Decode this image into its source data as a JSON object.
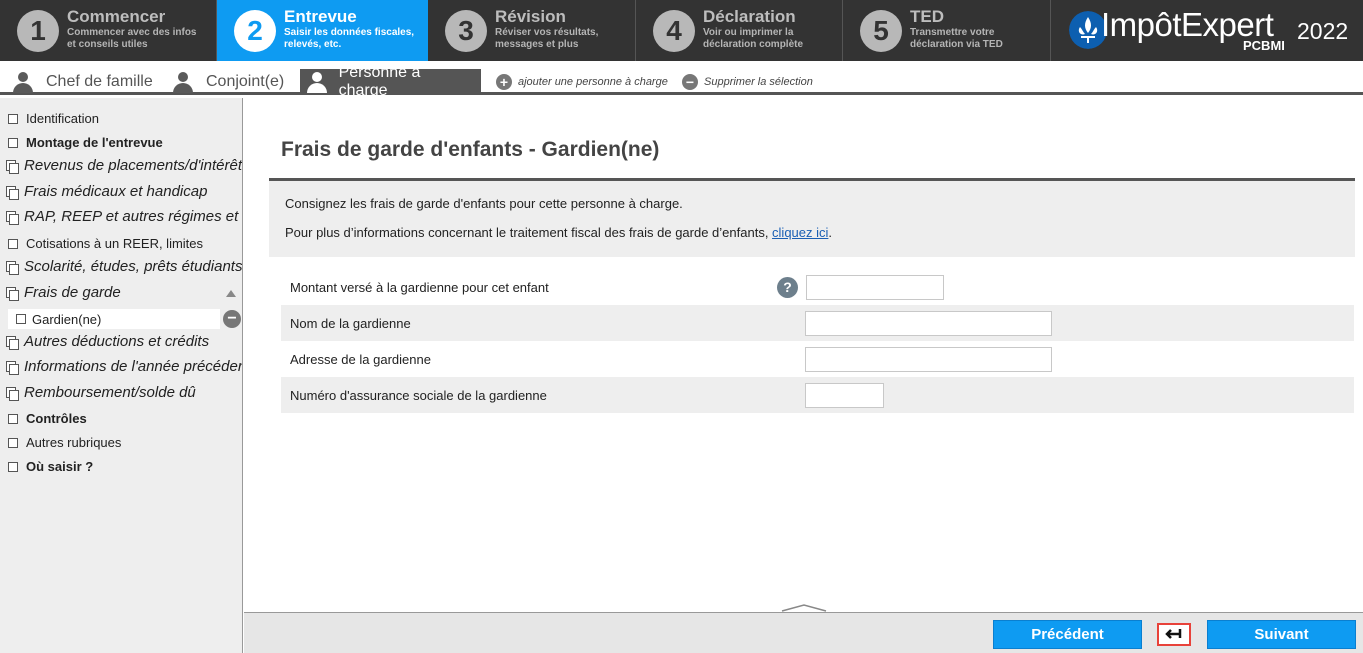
{
  "steps": [
    {
      "num": "1",
      "title": "Commencer",
      "desc1": "Commencer avec des infos",
      "desc2": "et conseils utiles"
    },
    {
      "num": "2",
      "title": "Entrevue",
      "desc1": "Saisir les données fiscales,",
      "desc2": "relevés, etc."
    },
    {
      "num": "3",
      "title": "Révision",
      "desc1": "Réviser vos résultats,",
      "desc2": "messages et plus"
    },
    {
      "num": "4",
      "title": "Déclaration",
      "desc1": "Voir ou imprimer la",
      "desc2": "déclaration complète"
    },
    {
      "num": "5",
      "title": "TED",
      "desc1": "Transmettre votre",
      "desc2": "déclaration via TED"
    }
  ],
  "brand": {
    "name": "ImpôtExpert",
    "year": "2022",
    "sub": "PCBMI"
  },
  "person_tabs": {
    "chef": "Chef de famille",
    "conjoint": "Conjoint(e)",
    "personne": "Personne à charge",
    "add": "ajouter une personne à charge",
    "remove": "Supprimer la sélection"
  },
  "sidebar": {
    "identification": "Identification",
    "montage": "Montage de l'entrevue",
    "revenus": "Revenus de placements/d'intérêts",
    "frais_medicaux": "Frais médicaux et handicap",
    "rap": "RAP, REEP et autres régimes et fonds",
    "cotisations": "Cotisations à un REER, limites",
    "scolarite": "Scolarité, études, prêts étudiants",
    "frais_garde": "Frais de garde",
    "gardien": "Gardien(ne)",
    "autres_deductions": "Autres déductions et crédits",
    "informations": "Informations de l'année précédente",
    "remboursement": "Remboursement/solde dû",
    "controles": "Contrôles",
    "autres_rubriques": "Autres rubriques",
    "ou_saisir": "Où saisir ?"
  },
  "main": {
    "title": "Frais de garde d'enfants - Gardien(ne)",
    "info1": "Consignez les frais de garde d'enfants pour cette personne à charge.",
    "info2_prefix": "Pour plus d’informations concernant le traitement fiscal des frais de garde d’enfants, ",
    "info2_link": "cliquez ici",
    "info2_suffix": ".",
    "fields": {
      "montant": {
        "label": "Montant versé à la gardienne pour cet enfant",
        "value": ""
      },
      "nom": {
        "label": "Nom de la gardienne",
        "value": ""
      },
      "adresse": {
        "label": "Adresse de la gardienne",
        "value": ""
      },
      "nas": {
        "label": "Numéro d'assurance sociale de la gardienne",
        "value": ""
      }
    },
    "help": "?"
  },
  "footer": {
    "prev": "Précédent",
    "next": "Suivant"
  },
  "colors": {
    "accent": "#0e9bf2",
    "dark": "#333333",
    "back_border": "#e8423a"
  }
}
